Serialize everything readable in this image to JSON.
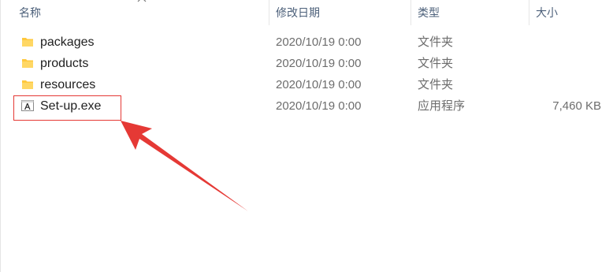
{
  "columns": {
    "name": "名称",
    "date_modified": "修改日期",
    "type": "类型",
    "size": "大小"
  },
  "files": [
    {
      "name": "packages",
      "date": "2020/10/19 0:00",
      "type": "文件夹",
      "size": "",
      "icon": "folder-icon"
    },
    {
      "name": "products",
      "date": "2020/10/19 0:00",
      "type": "文件夹",
      "size": "",
      "icon": "folder-icon"
    },
    {
      "name": "resources",
      "date": "2020/10/19 0:00",
      "type": "文件夹",
      "size": "",
      "icon": "folder-icon"
    },
    {
      "name": "Set-up.exe",
      "date": "2020/10/19 0:00",
      "type": "应用程序",
      "size": "7,460 KB",
      "icon": "adobe-app-icon"
    }
  ],
  "colors": {
    "header_text": "#4c607a",
    "annotation": "#e53935",
    "folder": "#ffc83d"
  }
}
